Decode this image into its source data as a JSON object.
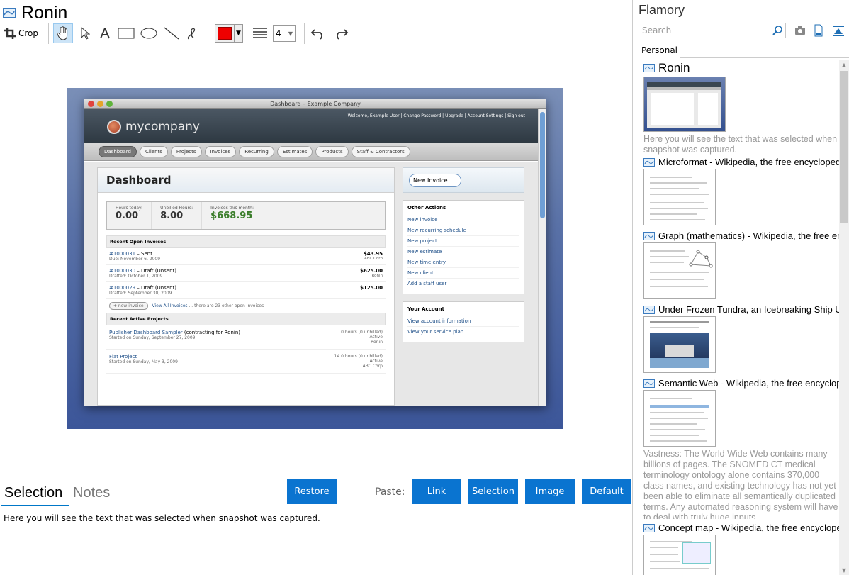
{
  "window": {
    "title": "Ronin"
  },
  "toolbar": {
    "crop_label": "Crop",
    "line_width": "4"
  },
  "snapshot": {
    "window_title": "Dashboard – Example Company",
    "logo": "mycompany",
    "top_links": "Welcome, Example User | Change Password | Upgrade | Account Settings | Sign out",
    "nav": [
      "Dashboard",
      "Clients",
      "Projects",
      "Invoices",
      "Recurring",
      "Estimates",
      "Products",
      "Staff & Contractors"
    ],
    "heading": "Dashboard",
    "stats": [
      {
        "label": "Hours today:",
        "value": "0.00"
      },
      {
        "label": "Unbilled Hours:",
        "value": "8.00"
      },
      {
        "label": "Invoices this month:",
        "value": "$668.95"
      }
    ],
    "invoices_heading": "Recent Open Invoices",
    "invoices": [
      {
        "id": "#1000031",
        "status": "– Sent",
        "sub": "Due: November 6, 2009",
        "amount": "$43.95",
        "client": "ABC Corp"
      },
      {
        "id": "#1000030",
        "status": "– Draft (Unsent)",
        "sub": "Drafted: October 1, 2009",
        "amount": "$625.00",
        "client": "Ronin"
      },
      {
        "id": "#1000029",
        "status": "– Draft (Unsent)",
        "sub": "Drafted: September 30, 2009",
        "amount": "$125.00",
        "client": ""
      }
    ],
    "invoice_footer_btn": "+ new invoice",
    "invoice_footer_link": "View All Invoices",
    "invoice_footer_text": "... there are 23 other open invoices",
    "projects_heading": "Recent Active Projects",
    "projects": [
      {
        "name": "Publisher Dashboard Sampler",
        "extra": "(contracting for Ronin)",
        "sub": "Started on Sunday, September 27, 2009",
        "hours": "0 hours (0 unbilled)",
        "state": "Active",
        "client": "Ronin"
      },
      {
        "name": "Flat Project",
        "extra": "",
        "sub": "Started on Sunday, May 3, 2009",
        "hours": "14.0 hours (0 unbilled)",
        "state": "Active",
        "client": "ABC Corp"
      }
    ],
    "new_invoice": "New Invoice",
    "other_actions_heading": "Other Actions",
    "other_actions": [
      "New invoice",
      "New recurring schedule",
      "New project",
      "New estimate",
      "New time entry",
      "New client",
      "Add a staff user"
    ],
    "account_heading": "Your Account",
    "account_links": [
      "View account information",
      "View your service plan"
    ]
  },
  "bottom": {
    "tab_selection": "Selection",
    "tab_notes": "Notes",
    "restore": "Restore",
    "paste_label": "Paste:",
    "paste_buttons": [
      "Link",
      "Selection",
      "Image",
      "Default"
    ],
    "selection_text": "Here you will see the text that was selected when snapshot was captured."
  },
  "side": {
    "title": "Flamory",
    "search_placeholder": "Search",
    "tab": "Personal",
    "items": [
      {
        "title": "Ronin",
        "desc": "Here you will see the text that was selected when snapshot was captured."
      },
      {
        "title": "Microformat - Wikipedia, the free encyclopedia"
      },
      {
        "title": "Graph (mathematics) - Wikipedia, the free ency"
      },
      {
        "title": "Under Frozen Tundra, an Icebreaking Ship Unco"
      },
      {
        "title": "Semantic Web - Wikipedia, the free encycloped",
        "desc": "Vastness: The World Wide Web contains many billions of pages. The SNOMED CT medical terminology ontology alone contains 370,000 class names, and existing technology has not yet been able to eliminate all semantically duplicated terms. Any automated reasoning system will have to deal with truly huge inputs."
      },
      {
        "title": "Concept map - Wikipedia, the free encyclopedi"
      }
    ]
  }
}
